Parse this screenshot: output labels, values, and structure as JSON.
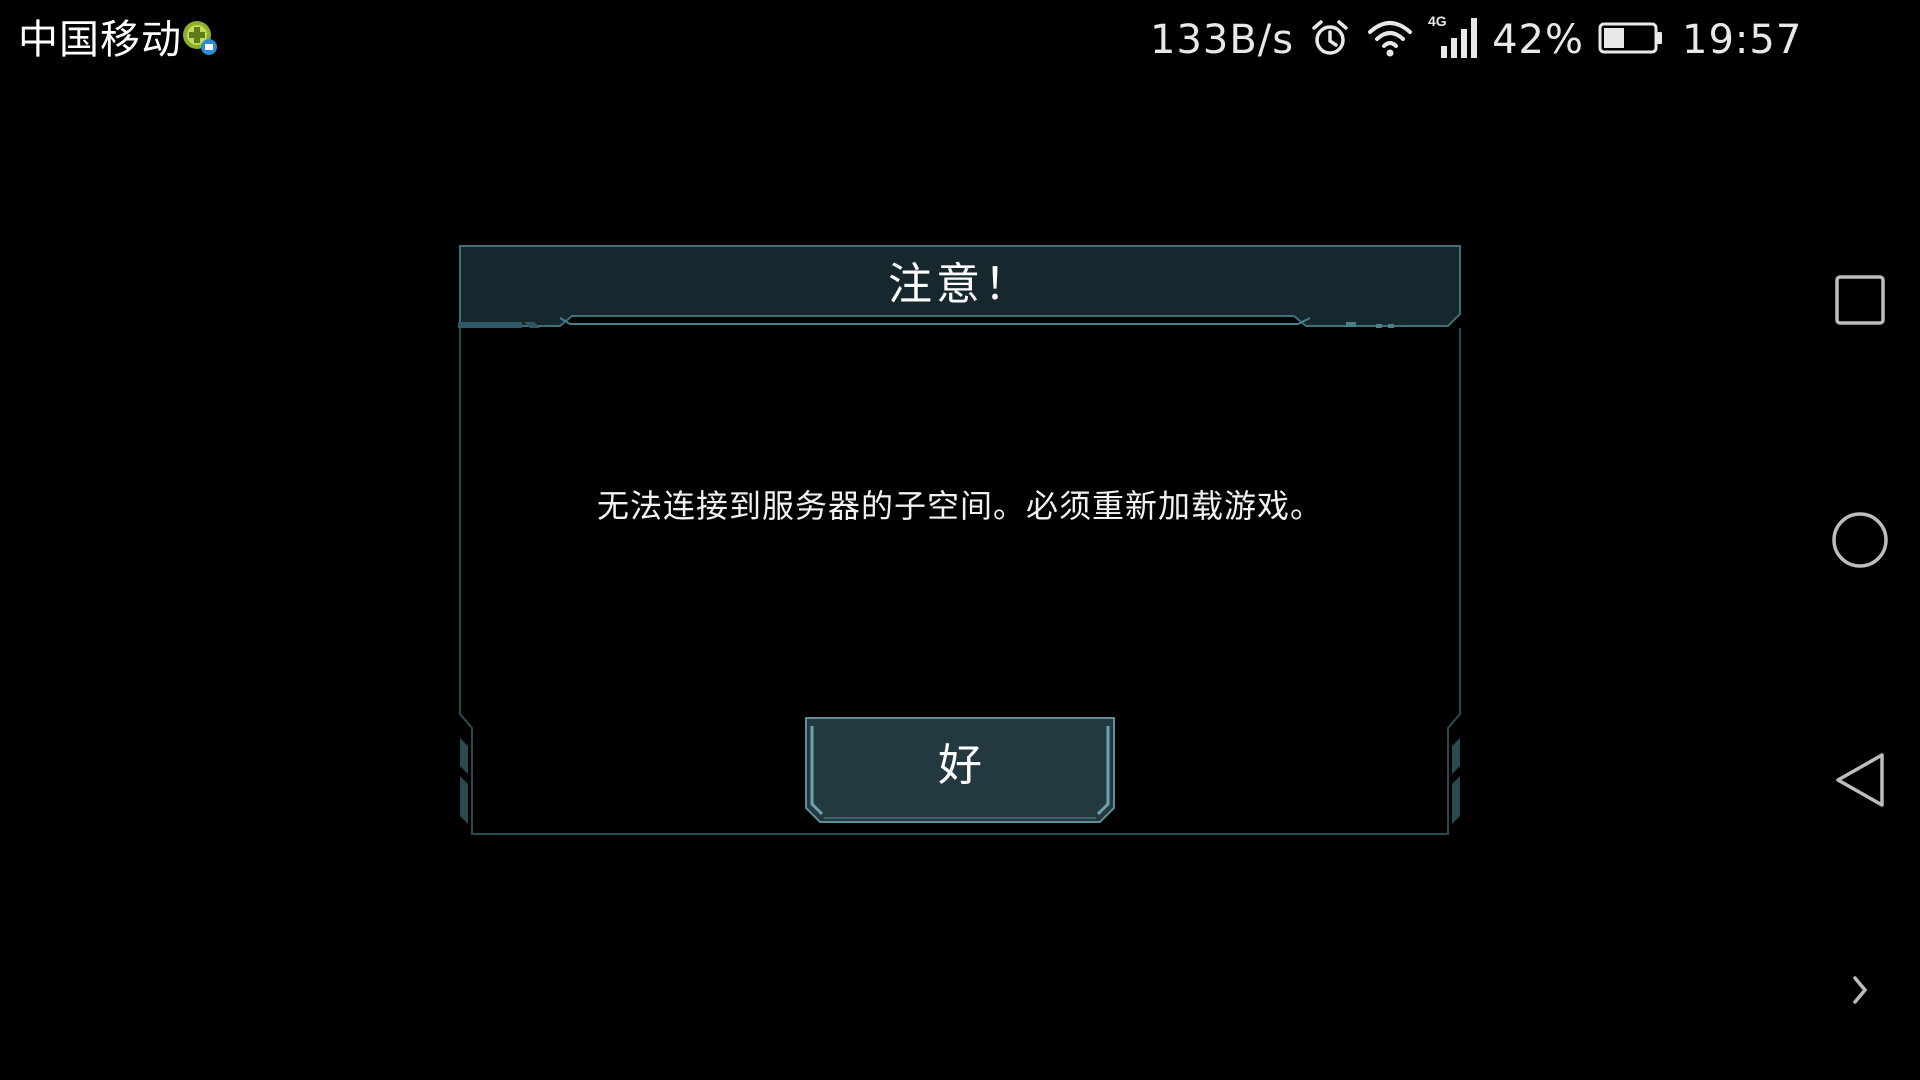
{
  "status_bar": {
    "carrier": "中国移动",
    "network_speed": "133B/s",
    "network_type": "4G",
    "battery_percent": "42%",
    "battery_level": 0.42,
    "time": "19:57",
    "icons": [
      "carrier-badge-icon",
      "alarm-icon",
      "wifi-icon",
      "cellular-signal-icon",
      "battery-icon"
    ]
  },
  "dialog": {
    "title": "注意！",
    "message": "无法连接到服务器的子空间。必须重新加载游戏。",
    "ok_label": "好"
  },
  "nav_bar": {
    "buttons": [
      "recent-apps-button",
      "home-button",
      "back-button",
      "expand-button"
    ]
  },
  "colors": {
    "background": "#000000",
    "frame_stroke": "#2f5b66",
    "title_bar": "#16282d",
    "button_fill": "#24393f",
    "text": "#ffffff"
  }
}
